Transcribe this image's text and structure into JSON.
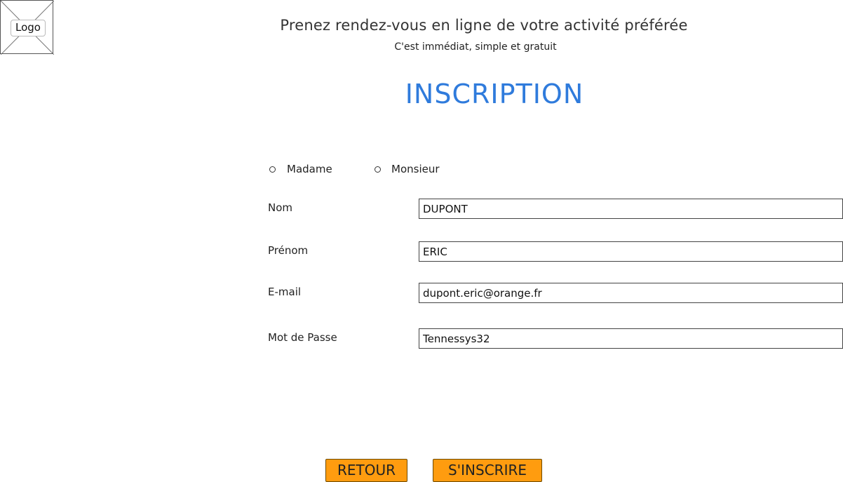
{
  "logo": {
    "label": "Logo"
  },
  "header": {
    "headline": "Prenez rendez-vous en ligne de votre activité préférée",
    "tagline": "C'est immédiat, simple et gratuit"
  },
  "form": {
    "title": "INSCRIPTION",
    "civility": [
      {
        "label": "Madame",
        "selected": false
      },
      {
        "label": "Monsieur",
        "selected": false
      }
    ],
    "fields": {
      "nom": {
        "label": "Nom",
        "value": "DUPONT"
      },
      "prenom": {
        "label": "Prénom",
        "value": "ERIC"
      },
      "email": {
        "label": "E-mail",
        "value": "dupont.eric@orange.fr"
      },
      "password": {
        "label": "Mot de Passe",
        "value": "Tennessys32"
      }
    }
  },
  "actions": {
    "back_label": "RETOUR",
    "submit_label": "S'INSCRIRE",
    "button_color": "#ff9c0f"
  },
  "colors": {
    "title": "#2f7bdc"
  }
}
